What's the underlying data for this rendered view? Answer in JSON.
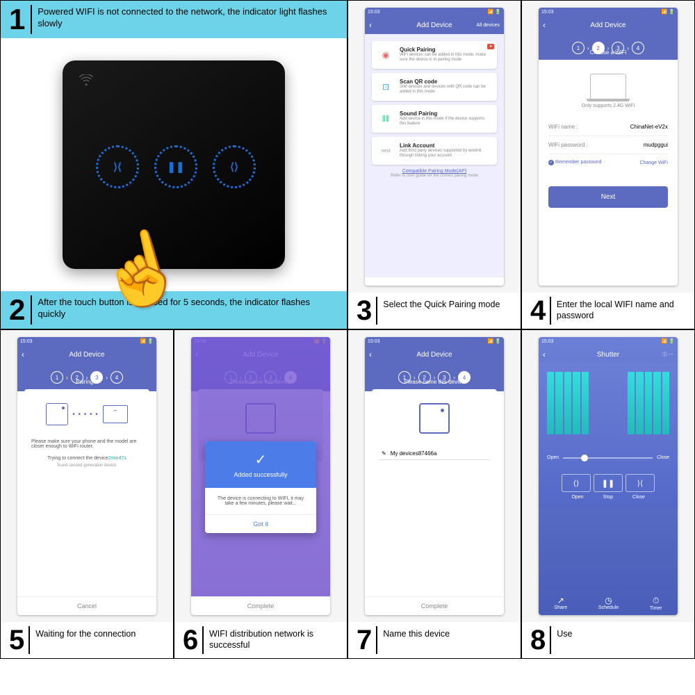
{
  "step1_text": "Powered WIFI is not connected to the network, the indicator light flashes slowly",
  "step2_text": "After the touch button is pressed for 5 seconds, the indicator flashes quickly",
  "step3_text": "Select the Quick Pairing mode",
  "step4_text": "Enter the local WIFI name and password",
  "step5_text": "Waiting for the connection",
  "step6_text": "WIFI distribution network is successful",
  "step7_text": "Name this device",
  "step8_text": "Use",
  "nums": {
    "n1": "1",
    "n2": "2",
    "n3": "3",
    "n3b": "3",
    "n4": "4",
    "n5": "5",
    "n6": "6",
    "n7": "7",
    "n8": "8"
  },
  "phone_time_a": "15:03",
  "phone_time_b": "15:04",
  "add_device_title": "Add Device",
  "all_devices": "All devices",
  "shutter_title": "Shutter",
  "cards": {
    "quick": {
      "title": "Quick Pairing",
      "sub": "WiFi devices can be added in this mode, make sure the device is in pairing mode",
      "badge": "●"
    },
    "scan": {
      "title": "Scan QR code",
      "sub": "SIM devices and devices with QR code can be added in this mode"
    },
    "sound": {
      "title": "Sound Pairing",
      "sub": "Add device in this mode if the device supports this feature"
    },
    "link": {
      "title": "Link Account",
      "sub": "Add third party devices supported by wrelink through linking your account"
    }
  },
  "compatible_link": "Compatible Pairing Mode(AP)",
  "refer_note": "Refer to user guide for the correct pairing mode",
  "choose_wifi": "Choose a WiFi",
  "wifi_support_note": "Only supports 2.4G WiFi",
  "wifi_name_label": "WiFi name :",
  "wifi_name_value": "ChinaNet-eV2x",
  "wifi_pass_label": "WiFi password :",
  "wifi_pass_value": "mudpggui",
  "remember_label": "Remember password",
  "change_wifi": "Change WiFi",
  "next_btn": "Next",
  "pairing_label": "Pairing...",
  "name_device_label": "Please name this device",
  "pairing_note": "Please make sure your phone and the model are closer enough to WiFi router.",
  "trying_prefix": "Trying to connect the device",
  "trying_time": "2min47s",
  "found_text": "found second generation device",
  "cancel_btn": "Cancel",
  "complete_btn": "Complete",
  "dialog_title": "Added successfully",
  "dialog_body": "The device is connecting to WIFI, it may take a few minutes, please wait...",
  "dialog_ok": "Got it",
  "device_name_value": "My devices87466a",
  "shutter": {
    "open": "Open",
    "close": "Close",
    "stop": "Stop",
    "share": "Share",
    "schedule": "Schedule",
    "timer": "Timer"
  }
}
